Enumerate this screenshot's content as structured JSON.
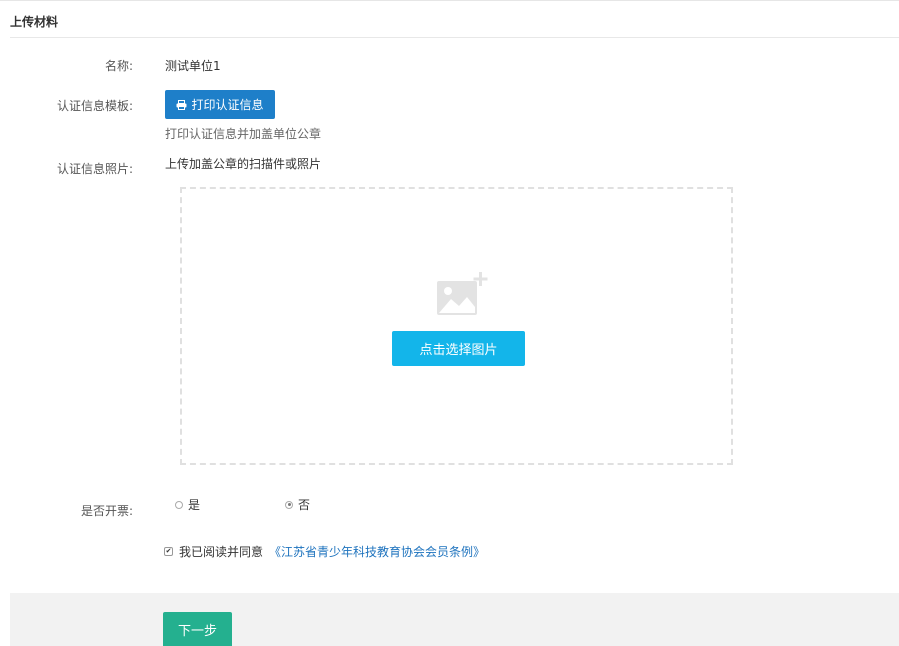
{
  "section": {
    "title": "上传材料"
  },
  "form": {
    "name_label": "名称:",
    "name_value": "测试单位1",
    "template_label": "认证信息模板:",
    "print_button": "打印认证信息",
    "print_hint": "打印认证信息并加盖单位公章",
    "photo_label": "认证信息照片:",
    "photo_hint": "上传加盖公章的扫描件或照片",
    "choose_image_button": "点击选择图片",
    "invoice_label": "是否开票:",
    "invoice_options": [
      {
        "label": "是",
        "selected": false
      },
      {
        "label": "否",
        "selected": true
      }
    ],
    "agree_checked": true,
    "agree_text": "我已阅读并同意",
    "agree_link": "《江苏省青少年科技教育协会会员条例》"
  },
  "footer": {
    "next_button": "下一步"
  },
  "colors": {
    "print_button_bg": "#1e7fc9",
    "choose_button_bg": "#13b5ea",
    "next_button_bg": "#24b08f",
    "link": "#1e73be"
  },
  "icons": {
    "print": "printer-icon",
    "image_placeholder": "image-add-icon"
  }
}
